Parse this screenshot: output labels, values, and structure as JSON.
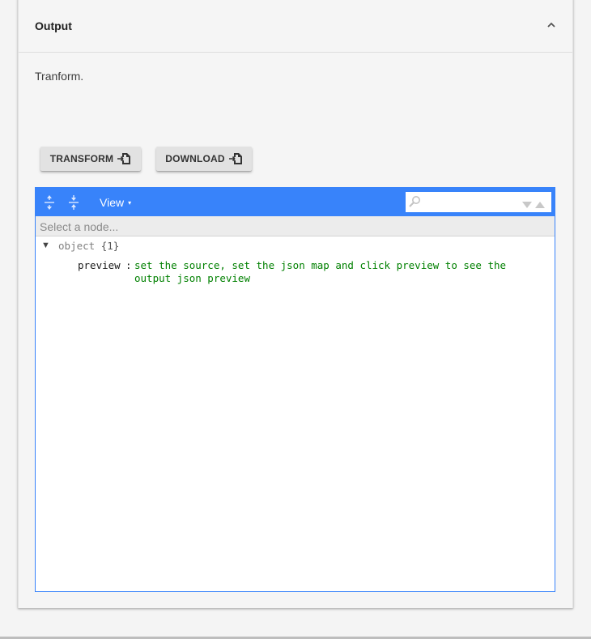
{
  "panel": {
    "title": "Output",
    "collapse_icon": "chevron-up-icon",
    "description": "Tranform."
  },
  "buttons": {
    "transform_label": "TRANSFORM",
    "download_label": "DOWNLOAD",
    "button_icon": "file-import-icon"
  },
  "editor": {
    "accent_color": "#3883fa",
    "toolbar": {
      "expand_icon": "expand-all-icon",
      "collapse_icon": "collapse-all-icon",
      "view_label": "View",
      "view_caret": "▾",
      "search_icon": "search-icon",
      "search_placeholder": ""
    },
    "navbar_text": "Select a node...",
    "tree": {
      "toggle": "▼",
      "root_type": "object",
      "root_count": "{1}",
      "key": "preview",
      "separator": ":",
      "value": "set the source, set the json map and click preview to see the output json preview",
      "value_color": "#008000"
    }
  }
}
